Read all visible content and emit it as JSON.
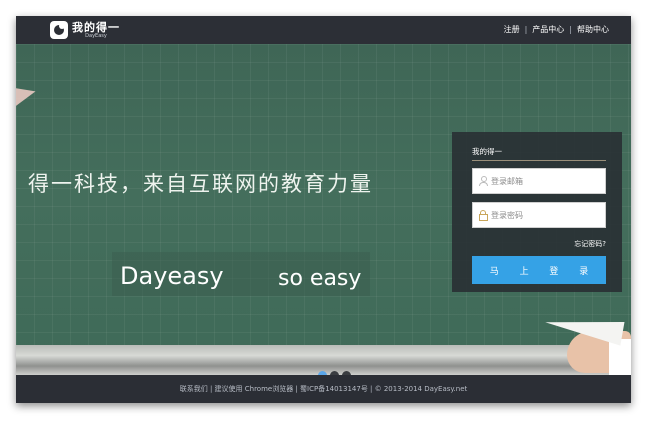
{
  "header": {
    "logo_name": "我的得一",
    "logo_sub": "DayEasy",
    "nav": [
      "注册",
      "产品中心",
      "帮助中心"
    ]
  },
  "hero": {
    "slogan": "得一科技，来自互联网的教育力量",
    "motto_part1": "Dayeasy",
    "motto_part2": "so easy",
    "carousel_count": 3,
    "carousel_active": 1
  },
  "login": {
    "title": "我的得一",
    "email_placeholder": "登录邮箱",
    "password_placeholder": "登录密码",
    "forgot": "忘记密码?",
    "submit": "马 上 登 录"
  },
  "footer": {
    "text": "联系我们 | 建议使用 Chrome浏览器 | 蜀ICP备14013147号 | © 2013-2014 DayEasy.net"
  },
  "colors": {
    "topbar": "#2c2f36",
    "chalkboard": "#446e5c",
    "login_panel": "#282e32",
    "button": "#35a2e6",
    "footer": "#2b2e35"
  }
}
